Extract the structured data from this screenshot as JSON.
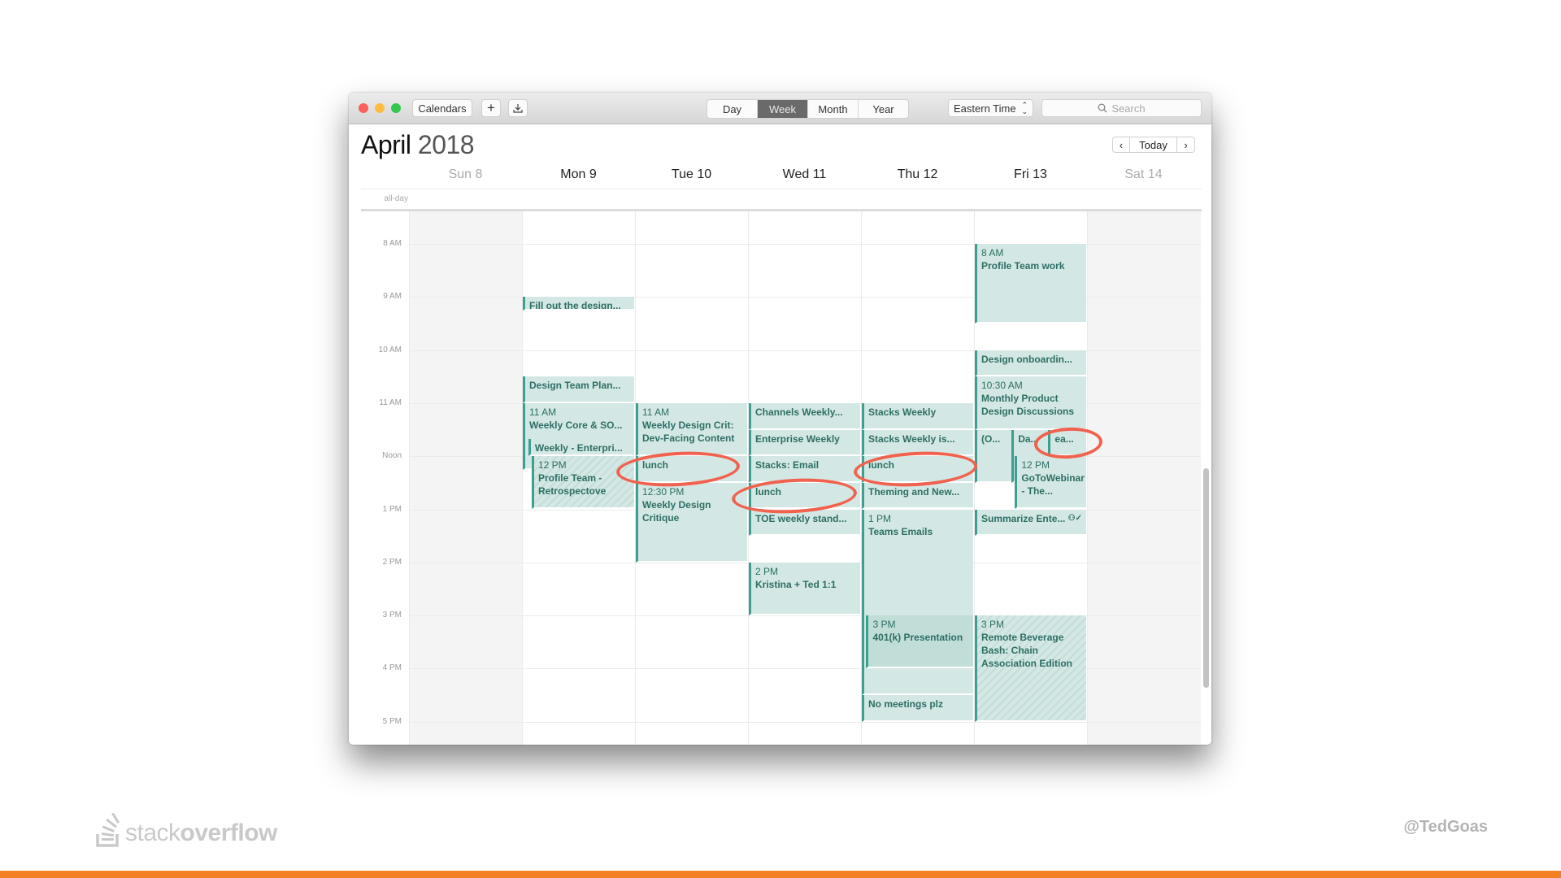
{
  "window": {
    "toolbar": {
      "calendars_label": "Calendars",
      "add_label": "+",
      "views": [
        "Day",
        "Week",
        "Month",
        "Year"
      ],
      "active_view": "Week",
      "timezone": "Eastern Time",
      "search_placeholder": "Search"
    },
    "header": {
      "month": "April",
      "year": "2018",
      "today_label": "Today",
      "prev_icon": "‹",
      "next_icon": "›"
    },
    "days": [
      "Sun 8",
      "Mon 9",
      "Tue 10",
      "Wed 11",
      "Thu 12",
      "Fri 13",
      "Sat 14"
    ],
    "allday_label": "all-day",
    "hours": [
      "8 AM",
      "9 AM",
      "10 AM",
      "11 AM",
      "Noon",
      "1 PM",
      "2 PM",
      "3 PM",
      "4 PM",
      "5 PM"
    ],
    "events": [
      {
        "day": 1,
        "start": 9.0,
        "end": 9.25,
        "title": "Fill out the design...",
        "time": ""
      },
      {
        "day": 1,
        "start": 10.5,
        "end": 11.0,
        "title": "Design Team Plan...",
        "time": ""
      },
      {
        "day": 1,
        "start": 11.0,
        "end": 12.25,
        "title": "Weekly Core & SO...",
        "time": "11 AM"
      },
      {
        "day": 1,
        "start": 11.67,
        "end": 12.0,
        "title": "Weekly - Enterpri...",
        "time": ""
      },
      {
        "day": 1,
        "start": 12.0,
        "end": 13.0,
        "title": "Profile Team - Retrospectove",
        "time": "12 PM"
      },
      {
        "day": 2,
        "start": 11.0,
        "end": 12.0,
        "title": "Weekly Design Crit: Dev-Facing Content",
        "time": "11 AM"
      },
      {
        "day": 2,
        "start": 12.0,
        "end": 12.5,
        "title": "lunch",
        "time": ""
      },
      {
        "day": 2,
        "start": 12.5,
        "end": 14.0,
        "title": "Weekly Design Critique",
        "time": "12:30 PM"
      },
      {
        "day": 3,
        "start": 11.0,
        "end": 11.5,
        "title": "Channels Weekly...",
        "time": ""
      },
      {
        "day": 3,
        "start": 11.5,
        "end": 12.0,
        "title": "Enterprise Weekly",
        "time": ""
      },
      {
        "day": 3,
        "start": 12.0,
        "end": 12.5,
        "title": "Stacks: Email",
        "time": ""
      },
      {
        "day": 3,
        "start": 12.5,
        "end": 13.0,
        "title": "lunch",
        "time": ""
      },
      {
        "day": 3,
        "start": 13.0,
        "end": 13.5,
        "title": "TOE weekly stand...",
        "time": ""
      },
      {
        "day": 3,
        "start": 14.0,
        "end": 15.0,
        "title": "Kristina + Ted 1:1",
        "time": "2 PM"
      },
      {
        "day": 4,
        "start": 11.0,
        "end": 11.5,
        "title": "Stacks Weekly",
        "time": ""
      },
      {
        "day": 4,
        "start": 11.5,
        "end": 12.0,
        "title": "Stacks Weekly is...",
        "time": ""
      },
      {
        "day": 4,
        "start": 12.0,
        "end": 12.5,
        "title": "lunch",
        "time": ""
      },
      {
        "day": 4,
        "start": 12.5,
        "end": 13.0,
        "title": "Theming and New...",
        "time": ""
      },
      {
        "day": 4,
        "start": 13.0,
        "end": 16.5,
        "title": "Teams Emails",
        "time": "1 PM"
      },
      {
        "day": 4,
        "start": 15.0,
        "end": 16.0,
        "title": "401(k) Presentation",
        "time": "3 PM"
      },
      {
        "day": 4,
        "start": 16.5,
        "end": 17.0,
        "title": "No meetings plz",
        "time": ""
      },
      {
        "day": 5,
        "start": 8.0,
        "end": 9.5,
        "title": "Profile Team work",
        "time": "8 AM"
      },
      {
        "day": 5,
        "start": 10.0,
        "end": 10.5,
        "title": "Design onboardin...",
        "time": ""
      },
      {
        "day": 5,
        "start": 10.5,
        "end": 11.5,
        "title": "Monthly Product Design Discussions",
        "time": "10:30 AM"
      },
      {
        "day": 5,
        "start": 11.5,
        "end": 12.5,
        "title": "(O...",
        "time": ""
      },
      {
        "day": 5,
        "start": 11.5,
        "end": 12.5,
        "title": "Da...",
        "time": ""
      },
      {
        "day": 5,
        "start": 11.5,
        "end": 12.0,
        "title": "ea...",
        "time": ""
      },
      {
        "day": 5,
        "start": 12.0,
        "end": 13.0,
        "title": "GoToWebinar - The...",
        "time": "12 PM"
      },
      {
        "day": 5,
        "start": 13.0,
        "end": 13.5,
        "title": "Summarize Ente...",
        "time": ""
      },
      {
        "day": 5,
        "start": 15.0,
        "end": 17.0,
        "title": "Remote Beverage Bash: Chain Association Edition",
        "time": "3 PM"
      }
    ]
  },
  "footer": {
    "logo_light": "stack",
    "logo_bold": "overflow",
    "handle": "@TedGoas"
  },
  "colors": {
    "event_fill": "#d3e8e4",
    "event_border": "#3f9e8f",
    "annotation_circle": "#f0624d",
    "brand_orange": "#f48024"
  }
}
